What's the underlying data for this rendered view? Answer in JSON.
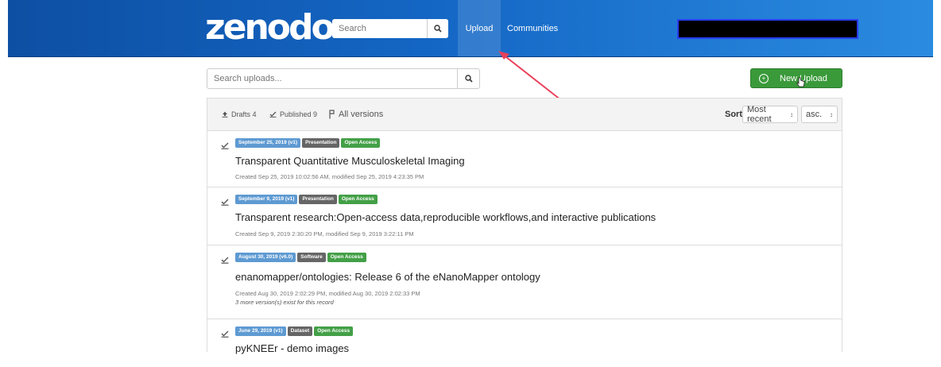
{
  "header": {
    "logo": "zenodo",
    "search_placeholder": "Search",
    "nav": {
      "upload": "Upload",
      "communities": "Communities"
    }
  },
  "uploads": {
    "search_placeholder": "Search uploads...",
    "new_upload_label": "New Upload"
  },
  "toolbar": {
    "drafts": "Drafts 4",
    "published": "Published 9",
    "all_versions": "All versions",
    "sort_label": "Sort",
    "sort_value": "Most recent",
    "order_value": "asc."
  },
  "records": [
    {
      "date_badge": "September 25, 2019 (v1)",
      "type_badge": "Presentation",
      "access_badge": "Open Access",
      "title": "Transparent Quantitative Musculoskeletal Imaging",
      "meta": "Created Sep 25, 2019 10:02:56 AM, modified Sep 25, 2019 4:23:35 PM"
    },
    {
      "date_badge": "September 9, 2019 (v1)",
      "type_badge": "Presentation",
      "access_badge": "Open Access",
      "title": "Transparent research:Open-access data,reproducible workflows,and interactive publications",
      "meta": "Created Sep 9, 2019 2:30:20 PM, modified Sep 9, 2019 3:22:11 PM"
    },
    {
      "date_badge": "August 30, 2019 (v6.0)",
      "type_badge": "Software",
      "access_badge": "Open Access",
      "title": "enanomapper/ontologies: Release 6 of the eNanoMapper ontology",
      "meta": "Created Aug 30, 2019 2:02:29 PM, modified Aug 30, 2019 2:02:33 PM",
      "note": "3 more version(s) exist for this record"
    },
    {
      "date_badge": "June 29, 2019 (v1)",
      "type_badge": "Dataset",
      "access_badge": "Open Access",
      "title": "pyKNEEr - demo images"
    }
  ],
  "colors": {
    "header_start": "#0d4fa3",
    "header_end": "#2a8be0",
    "new_upload": "#3a9a3a",
    "badge_date": "#5e9ad2",
    "badge_type": "#666666",
    "badge_access": "#43a047",
    "annotation_arrow": "#e8405a"
  }
}
